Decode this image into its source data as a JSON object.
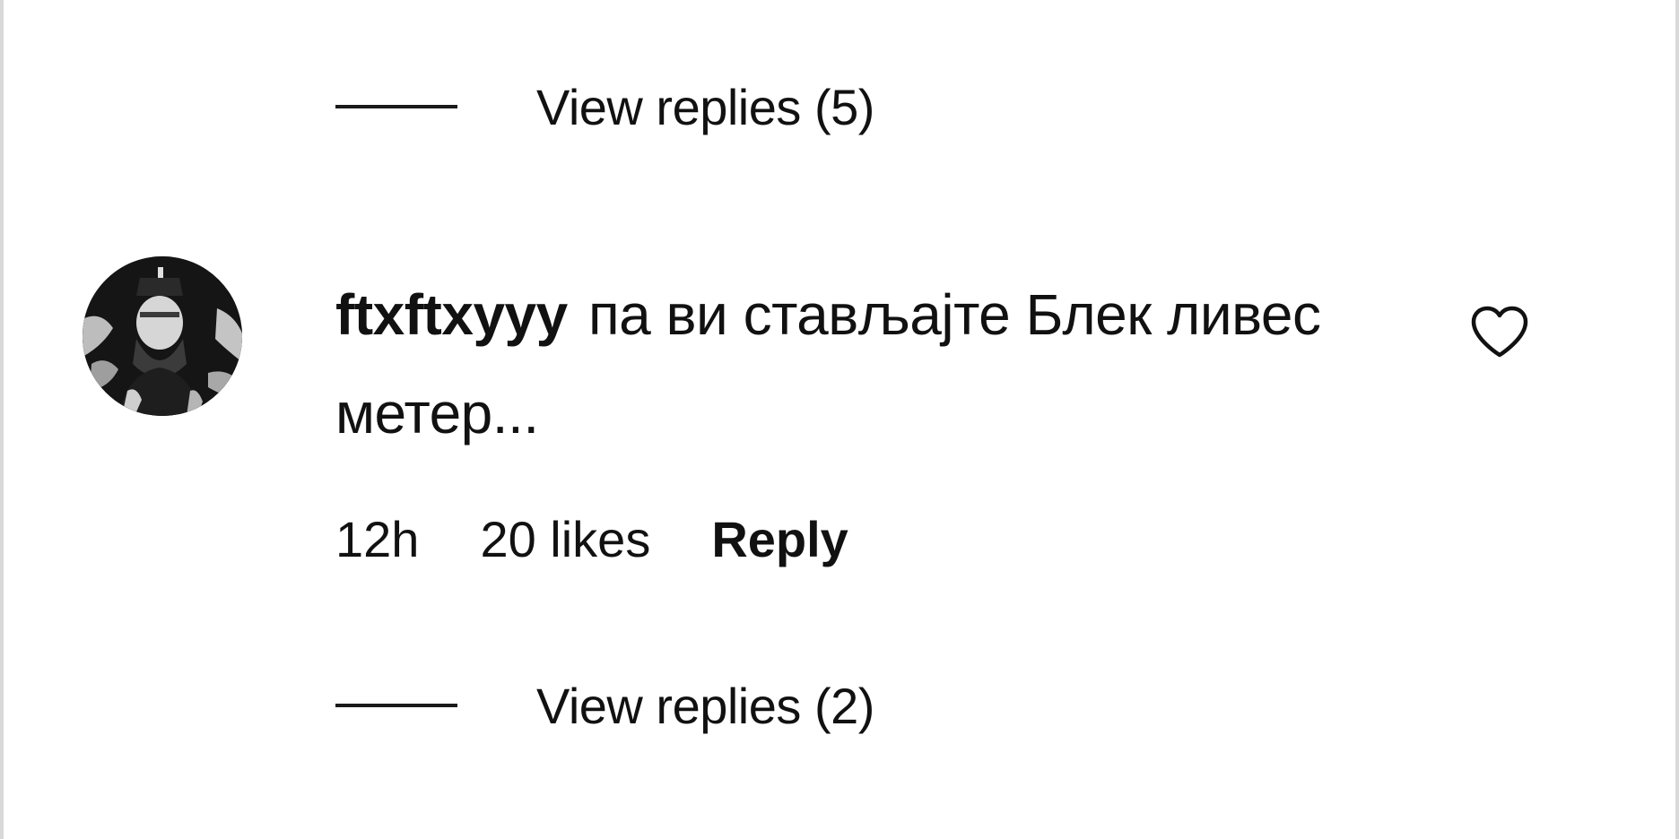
{
  "replies_top": {
    "label": "View replies (5)"
  },
  "comment": {
    "username": "ftxftxyyy",
    "text": "па ви стављајте Блек ливес метер...",
    "time": "12h",
    "likes": "20 likes",
    "reply_label": "Reply",
    "like_icon": "heart-outline-icon",
    "avatar_icon": "user-avatar"
  },
  "replies_bottom": {
    "label": "View replies (2)"
  },
  "colors": {
    "text": "#111111",
    "background": "#ffffff",
    "border": "#d9d9d9"
  }
}
